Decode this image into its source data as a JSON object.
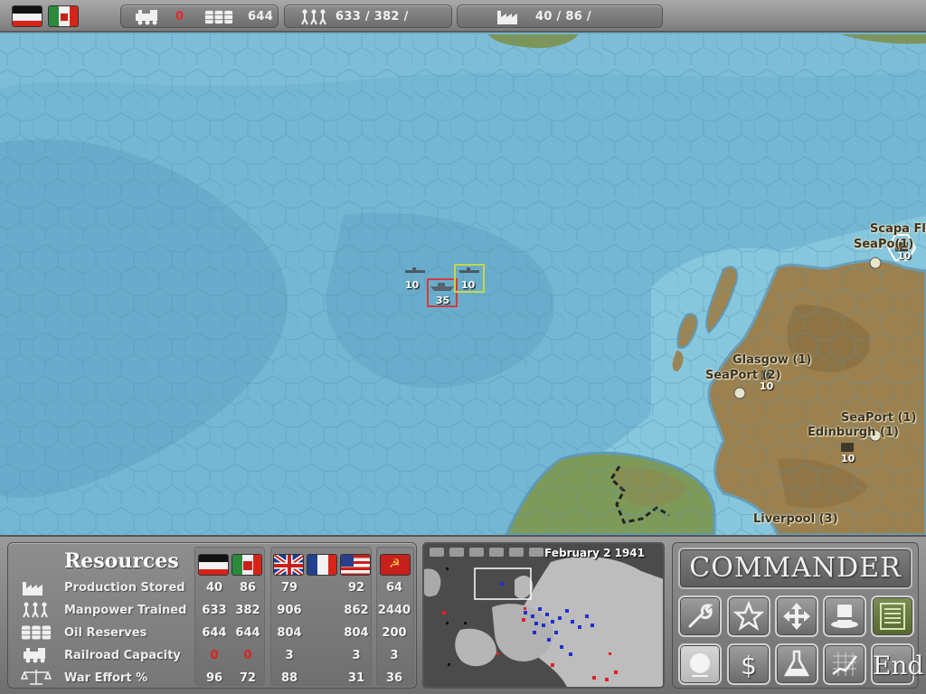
{
  "top_bar": {
    "flags": [
      "germany-empire-flag",
      "italy-flag"
    ],
    "railroad_value": "0",
    "oil_value": "644",
    "manpower_values": "633 /  382 /",
    "production_values": "40 /  86 /"
  },
  "map": {
    "cities": [
      {
        "name": "Scapa Fl"
      },
      {
        "name": "SeaPo(1)"
      },
      {
        "name": "Glasgow (1)"
      },
      {
        "name": "SeaPort (2)"
      },
      {
        "name": "SeaPort (1)"
      },
      {
        "name": "Edinburgh (1)"
      },
      {
        "name": "Liverpool (3)"
      }
    ],
    "units": [
      {
        "label": "10",
        "type": "submarine"
      },
      {
        "label": "35",
        "type": "battleship"
      },
      {
        "label": "10",
        "type": "submarine"
      },
      {
        "label": "10",
        "type": "garrison"
      },
      {
        "label": "10",
        "type": "garrison"
      },
      {
        "label": "10",
        "type": "garrison"
      }
    ]
  },
  "resources": {
    "title": "Resources",
    "rows": [
      {
        "label": "Production Stored",
        "icon": "factory-icon",
        "values": [
          "40",
          "86",
          "79",
          "92",
          "64"
        ]
      },
      {
        "label": "Manpower Trained",
        "icon": "soldiers-icon",
        "values": [
          "633",
          "382",
          "906",
          "862",
          "2440"
        ]
      },
      {
        "label": "Oil Reserves",
        "icon": "oil-barrels-icon",
        "values": [
          "644",
          "644",
          "804",
          "804",
          "200"
        ]
      },
      {
        "label": "Railroad Capacity",
        "icon": "locomotive-icon",
        "values": [
          "0",
          "0",
          "3",
          "3",
          "3"
        ]
      },
      {
        "label": "War Effort %",
        "icon": "scales-icon",
        "values": [
          "96",
          "72",
          "88",
          "31",
          "36"
        ]
      }
    ],
    "flags": [
      "germany-empire-flag",
      "italy-flag",
      "uk-flag",
      "france-flag",
      "usa-flag",
      "ussr-flag"
    ]
  },
  "minimap": {
    "date": "February 2 1941"
  },
  "commander": {
    "logo": "COMMANDER",
    "end_label": "End",
    "buttons": [
      "wrench-icon",
      "star-icon",
      "move-arrows-icon",
      "top-hat-icon",
      "list-icon",
      "globe-icon",
      "dollar-icon",
      "flask-icon",
      "graph-icon",
      "End"
    ]
  },
  "colors": {
    "sea": "#6fb3cf",
    "land": "#9a7f4c",
    "panel": "#8a8a8a",
    "red_value": "#d9221f"
  }
}
